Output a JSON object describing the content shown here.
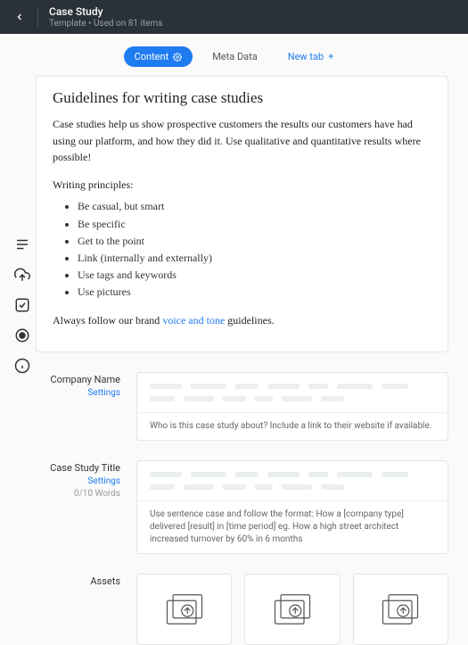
{
  "header": {
    "title": "Case Study",
    "subtitle": "Template • Used on 81 items"
  },
  "tabs": {
    "content": "Content",
    "meta": "Meta Data",
    "newtab": "New tab"
  },
  "guidelines": {
    "heading": "Guidelines for writing case studies",
    "intro": "Case studies help us show prospective customers the results our customers have had using our platform, and how they did it. Use qualitative and quantitative results where possible!",
    "principles_title": "Writing principles:",
    "principles": [
      "Be casual, but smart",
      "Be specific",
      "Get to the point",
      "Link (internally and externally)",
      "Use tags and keywords",
      "Use pictures"
    ],
    "footer_pre": "Always follow our brand ",
    "footer_link": "voice and tone",
    "footer_post": " guidelines."
  },
  "fields": {
    "company": {
      "label": "Company Name",
      "settings": "Settings",
      "help": "Who is this case study about? Include a link to their website if available."
    },
    "title": {
      "label": "Case Study Title",
      "settings": "Settings",
      "counter": "0/10 Words",
      "help": "Use sentence case and follow the format: How a [company type] delivered [result] in [time period] eg. How a high street architect increased turnover by 60% in 6 months"
    },
    "assets": {
      "label": "Assets"
    }
  }
}
